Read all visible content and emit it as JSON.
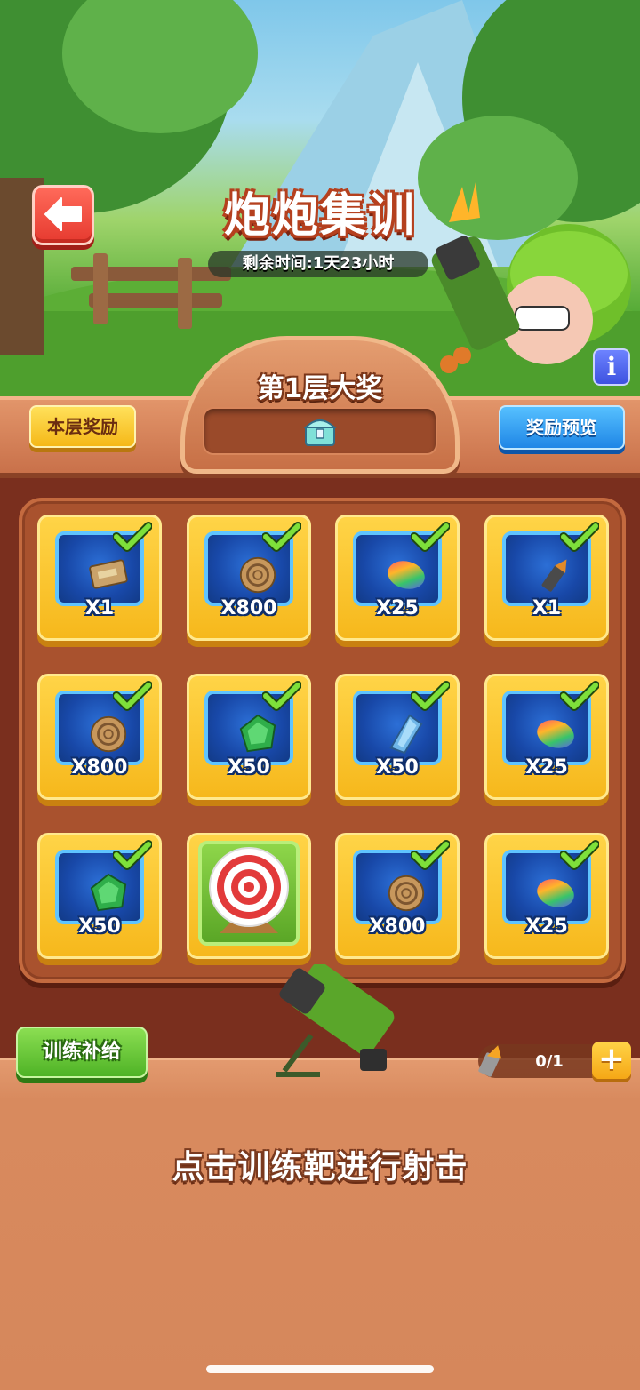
{
  "header": {
    "title": "炮炮集训",
    "time_remaining": "剩余时间:1天23小时"
  },
  "buttons": {
    "floor_reward": "本层奖励",
    "reward_preview": "奖励预览",
    "training_supply": "训练补给",
    "info": "i"
  },
  "grand_prize": {
    "title": "第1层大奖",
    "item": "treasure-chest"
  },
  "grid": [
    {
      "item": "ticket",
      "qty": "X1",
      "claimed": true
    },
    {
      "item": "wood-coin",
      "qty": "X800",
      "claimed": true
    },
    {
      "item": "rainbow-bean",
      "qty": "X25",
      "claimed": true
    },
    {
      "item": "bullet",
      "qty": "X1",
      "claimed": true
    },
    {
      "item": "wood-coin",
      "qty": "X800",
      "claimed": true
    },
    {
      "item": "green-gem",
      "qty": "X50",
      "claimed": true
    },
    {
      "item": "blue-crystal",
      "qty": "X50",
      "claimed": true
    },
    {
      "item": "rainbow-bean",
      "qty": "X25",
      "claimed": true
    },
    {
      "item": "green-gem",
      "qty": "X50",
      "claimed": true
    },
    {
      "item": "training-target",
      "qty": "",
      "claimed": false
    },
    {
      "item": "wood-coin",
      "qty": "X800",
      "claimed": true
    },
    {
      "item": "rainbow-bean",
      "qty": "X25",
      "claimed": true
    }
  ],
  "ammo": {
    "count": "0/1",
    "plus": "+"
  },
  "instruction": "点击训练靶进行射击",
  "colors": {
    "cell_gold": "#f6b81c",
    "tile_blue": "#1848a8",
    "check_green": "#6fd12e",
    "board_brown": "#a9522e"
  }
}
